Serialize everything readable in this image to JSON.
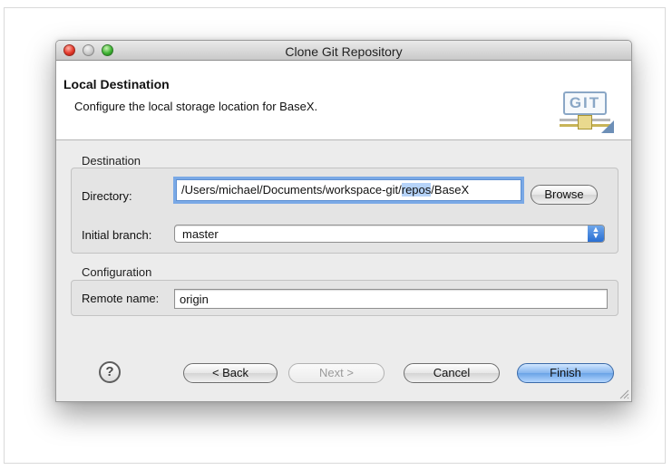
{
  "window": {
    "title": "Clone Git Repository"
  },
  "banner": {
    "title": "Local Destination",
    "description": "Configure the local storage location for BaseX.",
    "logo_text": "GIT"
  },
  "destination": {
    "group_title": "Destination",
    "directory_label": "Directory:",
    "directory_value_before": "/Users/michael/Documents/workspace-git/",
    "directory_value_selected": "repos",
    "directory_value_after": "/BaseX",
    "browse_label": "Browse",
    "branch_label": "Initial branch:",
    "branch_value": "master"
  },
  "configuration": {
    "group_title": "Configuration",
    "remote_label": "Remote name:",
    "remote_value": "origin"
  },
  "footer": {
    "back_label": "< Back",
    "next_label": "Next >",
    "cancel_label": "Cancel",
    "finish_label": "Finish",
    "help_glyph": "?"
  },
  "icons": {
    "help": "help-icon",
    "git_logo": "git-logo-icon",
    "popup_arrows": "up-down-arrows-icon",
    "resize_grip": "resize-grip-icon"
  }
}
